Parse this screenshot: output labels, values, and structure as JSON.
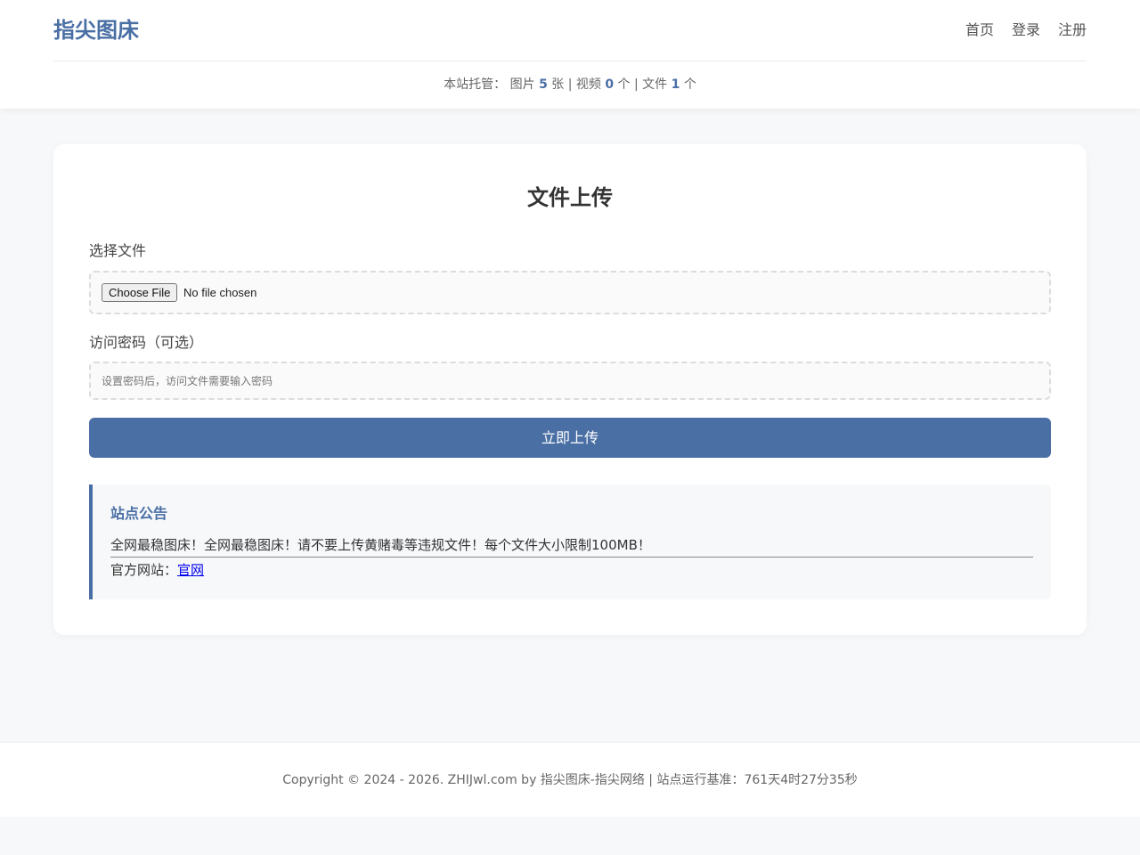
{
  "header": {
    "brand": "指尖图床",
    "nav": [
      {
        "label": "首页"
      },
      {
        "label": "登录"
      },
      {
        "label": "注册"
      }
    ],
    "stats": {
      "prefix": "本站托管：",
      "images_label": "图片",
      "images_count": "5",
      "images_unit": "张",
      "videos_label": "视频",
      "videos_count": "0",
      "videos_unit": "个",
      "files_label": "文件",
      "files_count": "1",
      "files_unit": "个"
    }
  },
  "upload": {
    "title": "文件上传",
    "file_label": "选择文件",
    "choose_button": "Choose File",
    "file_status": "No file chosen",
    "password_label": "访问密码（可选）",
    "password_placeholder": "设置密码后，访问文件需要输入密码",
    "submit_label": "立即上传"
  },
  "notice": {
    "title": "站点公告",
    "line1": "全网最稳图床！全网最稳图床！请不要上传黄赌毒等违规文件！每个文件大小限制100MB！",
    "line2_prefix": "官方网站：",
    "line2_link": "官网"
  },
  "footer": {
    "text": "Copyright © 2024 - 2026. ZHIJwl.com by 指尖图床-指尖网络 | 站点运行基准：761天4时27分35秒"
  },
  "colors": {
    "accent": "#4a6fa5",
    "page_bg": "#f7f8fa",
    "link": "#0000ee"
  }
}
